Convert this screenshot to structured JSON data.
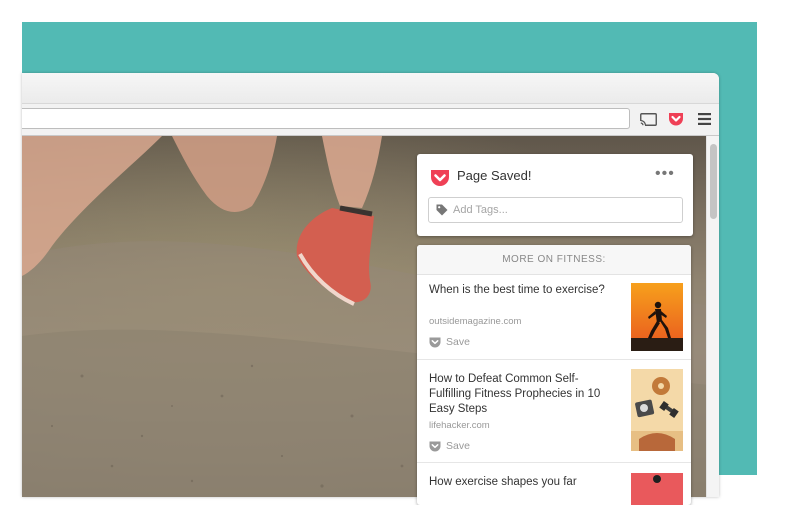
{
  "pocket": {
    "title": "Page Saved!",
    "more_label": "•••",
    "tags_placeholder": "Add Tags...",
    "brand_color": "#ef4056",
    "section_header": "MORE ON FITNESS:",
    "articles": [
      {
        "title": "When is the best time to exercise?",
        "source": "outsidemagazine.com",
        "save_label": "Save"
      },
      {
        "title": "How to Defeat Common Self-Fulfilling Fitness Prophecies in 10 Easy Steps",
        "source": "lifehacker.com",
        "save_label": "Save"
      },
      {
        "title": "How exercise shapes you far"
      }
    ]
  },
  "toolbar": {
    "icons": [
      "cast-icon",
      "pocket-icon",
      "menu-icon"
    ]
  },
  "colors": {
    "background_accent": "#52bab4"
  }
}
